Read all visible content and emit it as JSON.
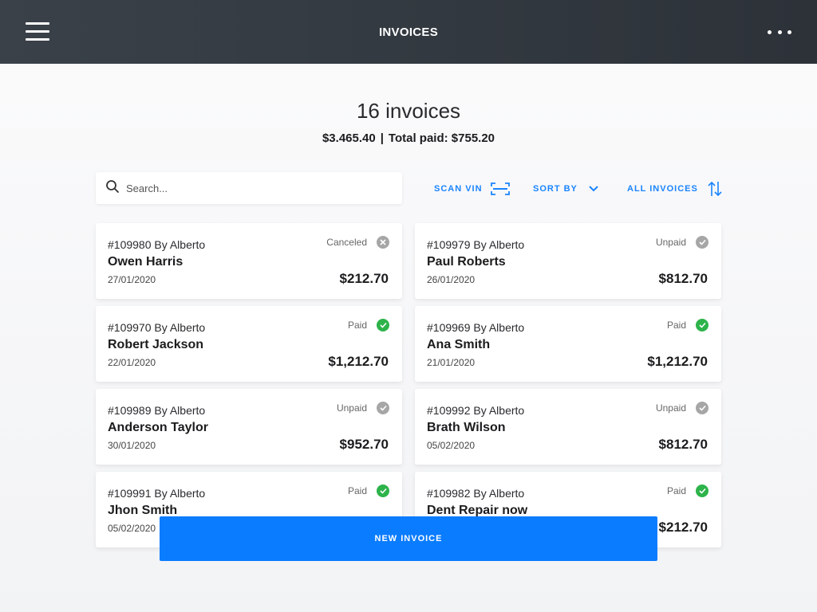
{
  "header": {
    "title": "INVOICES"
  },
  "summary": {
    "count_text": "16 invoices",
    "total": "$3.465.40",
    "separator": "|",
    "total_paid_text": "Total paid: $755.20"
  },
  "search": {
    "placeholder": "Search..."
  },
  "actions": {
    "scan_vin": "SCAN VIN",
    "sort_by": "SORT BY",
    "all_invoices": "ALL INVOICES"
  },
  "status_colors": {
    "Canceled": "#a6a6a6",
    "Unpaid": "#a6a6a6",
    "Paid": "#2db34a"
  },
  "accent_color": "#0a7cff",
  "invoices": [
    {
      "number": "#109980 By Alberto",
      "name": "Owen Harris",
      "date": "27/01/2020",
      "status": "Canceled",
      "amount": "$212.70"
    },
    {
      "number": "#109979 By Alberto",
      "name": "Paul Roberts",
      "date": "26/01/2020",
      "status": "Unpaid",
      "amount": "$812.70"
    },
    {
      "number": "#109970 By Alberto",
      "name": "Robert Jackson",
      "date": "22/01/2020",
      "status": "Paid",
      "amount": "$1,212.70"
    },
    {
      "number": "#109969 By Alberto",
      "name": "Ana Smith",
      "date": "21/01/2020",
      "status": "Paid",
      "amount": "$1,212.70"
    },
    {
      "number": "#109989 By Alberto",
      "name": "Anderson Taylor",
      "date": "30/01/2020",
      "status": "Unpaid",
      "amount": "$952.70"
    },
    {
      "number": "#109992 By Alberto",
      "name": "Brath Wilson",
      "date": "05/02/2020",
      "status": "Unpaid",
      "amount": "$812.70"
    },
    {
      "number": "#109991 By Alberto",
      "name": "Jhon Smith",
      "date": "05/02/2020",
      "status": "Paid",
      "amount": ""
    },
    {
      "number": "#109982 By Alberto",
      "name": "Dent Repair now",
      "date": "",
      "status": "Paid",
      "amount": "$212.70"
    }
  ],
  "new_invoice_button": "NEW INVOICE"
}
